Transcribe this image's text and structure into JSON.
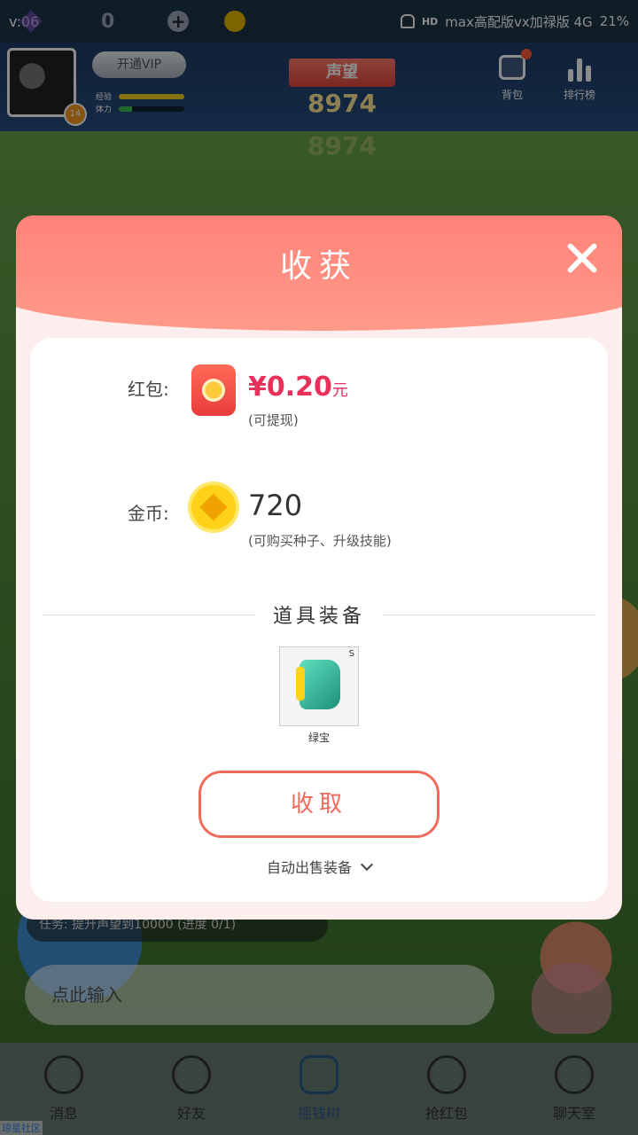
{
  "status_bar": {
    "time": "v:06",
    "stat_gems": "0",
    "right_text": "max高配版vx加禄版 4G",
    "hd": "HD",
    "battery": "21%"
  },
  "header": {
    "vip_label": "开通VIP",
    "level": "14",
    "stats": [
      {
        "label": "经验",
        "fill": 1.0,
        "color": "#f5d020"
      },
      {
        "label": "体力",
        "fill": 0.2,
        "color": "#3fbf5a"
      }
    ],
    "reputation_label": "声望",
    "reputation_value": "8974",
    "bag_label": "背包",
    "rank_label": "排行榜"
  },
  "modal": {
    "title": "收获",
    "red_packet_label": "红包:",
    "money_value": "¥0.20",
    "money_unit": "元",
    "money_note": "(可提现)",
    "coin_label": "金币:",
    "coin_value": "720",
    "coin_note": "(可购买种子、升级技能)",
    "section_title": "道具装备",
    "item": {
      "name": "绿宝",
      "tag": "S"
    },
    "collect_label": "收取",
    "auto_sell_label": "自动出售装备"
  },
  "background": {
    "task_text": "任务: 提升声望到10000 (进度 0/1)",
    "input_placeholder": "点此输入"
  },
  "bottom_nav": [
    {
      "label": "消息",
      "icon": "chat-bubble-icon"
    },
    {
      "label": "好友",
      "icon": "smile-face-icon"
    },
    {
      "label": "摇钱树",
      "icon": "leaf-icon"
    },
    {
      "label": "抢红包",
      "icon": "red-packet-icon"
    },
    {
      "label": "聊天室",
      "icon": "hi-bubble-icon"
    }
  ],
  "corner_text": "琼星社区"
}
